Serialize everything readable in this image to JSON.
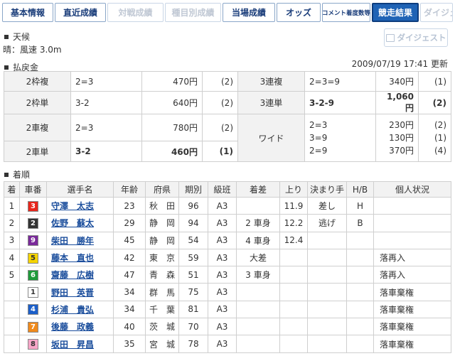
{
  "tabs": [
    {
      "label": "基本情報",
      "state": "normal"
    },
    {
      "label": "直近成績",
      "state": "normal"
    },
    {
      "label": "対戦成績",
      "state": "disabled"
    },
    {
      "label": "種目別成績",
      "state": "disabled"
    },
    {
      "label": "当場成績",
      "state": "normal"
    },
    {
      "label": "オッズ",
      "state": "normal"
    },
    {
      "label": "コメント着度数等",
      "state": "normal"
    },
    {
      "label": "競走結果",
      "state": "active"
    },
    {
      "label": "ダイジェスト",
      "state": "disabled"
    }
  ],
  "weather": {
    "heading": "天候",
    "text": "晴：風速 3.0m"
  },
  "digest_button": "ダイジェスト",
  "updated": "2009/07/19 17:41 更新",
  "payout": {
    "heading": "払戻金",
    "left": [
      {
        "label": "2枠複",
        "combo": "2=3",
        "amount": "470円",
        "pop": "(2)",
        "bold": false
      },
      {
        "label": "2枠単",
        "combo": "3-2",
        "amount": "640円",
        "pop": "(2)",
        "bold": false
      },
      {
        "label": "2車複",
        "combo": "2=3",
        "amount": "780円",
        "pop": "(2)",
        "bold": false
      },
      {
        "label": "2車単",
        "combo": "3-2",
        "amount": "460円",
        "pop": "(1)",
        "bold": true
      }
    ],
    "right": [
      {
        "label": "3連複",
        "combo": "2=3=9",
        "amount": "340円",
        "pop": "(1)",
        "bold": false
      },
      {
        "label": "3連単",
        "combo": "3-2-9",
        "amount": "1,060円",
        "pop": "(2)",
        "bold": true
      }
    ],
    "wide": {
      "label": "ワイド",
      "rows": [
        {
          "combo": "2=3",
          "amount": "230円",
          "pop": "(2)"
        },
        {
          "combo": "3=9",
          "amount": "130円",
          "pop": "(1)"
        },
        {
          "combo": "2=9",
          "amount": "370円",
          "pop": "(4)"
        }
      ]
    }
  },
  "results": {
    "heading": "着順",
    "columns": [
      "着",
      "車番",
      "選手名",
      "年齢",
      "府県",
      "期別",
      "級班",
      "着差",
      "上り",
      "決まり手",
      "H/B",
      "個人状況"
    ],
    "rows": [
      {
        "rank": "1",
        "car": "3",
        "name": "守澤　太志",
        "age": "23",
        "pref": "秋　田",
        "term": "96",
        "class": "A3",
        "margin": "",
        "agari": "11.9",
        "kimarite": "差し",
        "hb": "H",
        "status": ""
      },
      {
        "rank": "2",
        "car": "2",
        "name": "佐野　蘇太",
        "age": "29",
        "pref": "静　岡",
        "term": "94",
        "class": "A3",
        "margin": "2 車身",
        "agari": "12.2",
        "kimarite": "逃げ",
        "hb": "B",
        "status": ""
      },
      {
        "rank": "3",
        "car": "9",
        "name": "柴田　勝年",
        "age": "45",
        "pref": "静　岡",
        "term": "54",
        "class": "A3",
        "margin": "4 車身",
        "agari": "12.4",
        "kimarite": "",
        "hb": "",
        "status": ""
      },
      {
        "rank": "4",
        "car": "5",
        "name": "藤本　直也",
        "age": "42",
        "pref": "東　京",
        "term": "59",
        "class": "A3",
        "margin": "大差",
        "agari": "",
        "kimarite": "",
        "hb": "",
        "status": "落再入"
      },
      {
        "rank": "5",
        "car": "6",
        "name": "齋藤　広樹",
        "age": "47",
        "pref": "青　森",
        "term": "51",
        "class": "A3",
        "margin": "3 車身",
        "agari": "",
        "kimarite": "",
        "hb": "",
        "status": "落再入"
      },
      {
        "rank": "",
        "car": "1",
        "name": "野田　英晋",
        "age": "34",
        "pref": "群　馬",
        "term": "75",
        "class": "A3",
        "margin": "",
        "agari": "",
        "kimarite": "",
        "hb": "",
        "status": "落車棄権"
      },
      {
        "rank": "",
        "car": "4",
        "name": "杉浦　貴弘",
        "age": "34",
        "pref": "千　葉",
        "term": "81",
        "class": "A3",
        "margin": "",
        "agari": "",
        "kimarite": "",
        "hb": "",
        "status": "落車棄権"
      },
      {
        "rank": "",
        "car": "7",
        "name": "後藤　政義",
        "age": "40",
        "pref": "茨　城",
        "term": "70",
        "class": "A3",
        "margin": "",
        "agari": "",
        "kimarite": "",
        "hb": "",
        "status": "落車棄権"
      },
      {
        "rank": "",
        "car": "8",
        "name": "坂田　昇昌",
        "age": "35",
        "pref": "宮　城",
        "term": "78",
        "class": "A3",
        "margin": "",
        "agari": "",
        "kimarite": "",
        "hb": "",
        "status": "落車棄権"
      }
    ]
  },
  "car_colors": {
    "1": {
      "bg": "#ffffff",
      "fg": "#333333"
    },
    "2": {
      "bg": "#333333",
      "fg": "#ffffff"
    },
    "3": {
      "bg": "#e8261c",
      "fg": "#ffffff"
    },
    "4": {
      "bg": "#1c5fc9",
      "fg": "#ffffff"
    },
    "5": {
      "bg": "#f5d400",
      "fg": "#333333"
    },
    "6": {
      "bg": "#1f9a3a",
      "fg": "#ffffff"
    },
    "7": {
      "bg": "#f08a1c",
      "fg": "#ffffff"
    },
    "8": {
      "bg": "#f7a6c8",
      "fg": "#333333"
    },
    "9": {
      "bg": "#7a2a9a",
      "fg": "#ffffff"
    }
  }
}
